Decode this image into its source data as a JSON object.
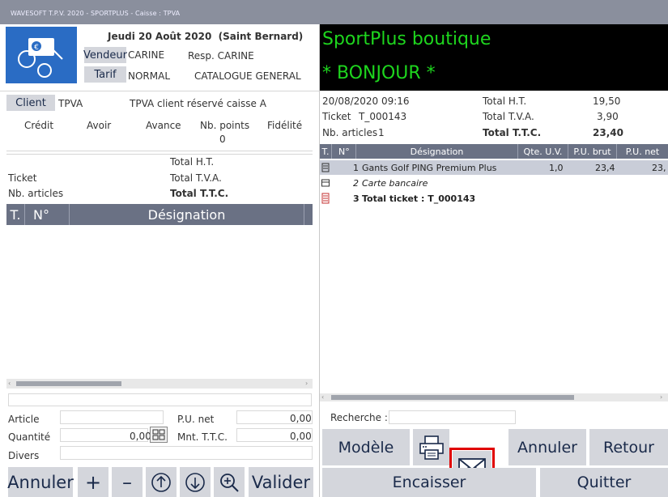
{
  "window": {
    "title": "WAVESOFT T.P.V. 2020 - SPORTPLUS - Caisse : TPVA"
  },
  "header": {
    "date": "Jeudi 20 Août 2020",
    "saint": "(Saint Bernard)",
    "vendeur_label": "Vendeur",
    "vendeur_value": "CARINE",
    "resp": "Resp. CARINE",
    "tarif_label": "Tarif",
    "tarif_value": "NORMAL",
    "catalogue": "CATALOGUE GENERAL"
  },
  "client": {
    "label": "Client",
    "code": "TPVA",
    "desc": "TPVA client réservé caisse A",
    "columns": [
      "Crédit",
      "Avoir",
      "Avance",
      "Nb. points",
      "Fidélité"
    ],
    "nb_points": "0"
  },
  "left_totals": {
    "total_ht": "Total H.T.",
    "ticket": "Ticket",
    "total_tva": "Total T.V.A.",
    "nb_articles": "Nb. articles",
    "total_ttc": "Total T.T.C."
  },
  "left_table": {
    "col_t": "T.",
    "col_n": "N°",
    "col_des": "Désignation"
  },
  "entry": {
    "article": "Article",
    "pu_net_label": "P.U. net",
    "pu_net_value": "0,00",
    "quantite": "Quantité",
    "quantite_value": "0,00",
    "mnt_label": "Mnt. T.T.C.",
    "mnt_value": "0,00",
    "divers": "Divers"
  },
  "left_buttons": {
    "annuler": "Annuler",
    "plus": "+",
    "minus": "–",
    "valider": "Valider"
  },
  "display": {
    "line1": "SportPlus boutique",
    "line2": "* BONJOUR *"
  },
  "ticket_info": {
    "datetime": "20/08/2020 09:16",
    "total_ht_label": "Total H.T.",
    "total_ht": "19,50",
    "ticket_label": "Ticket",
    "ticket_no": "T_000143",
    "total_tva_label": "Total T.V.A.",
    "total_tva": "3,90",
    "nb_articles_label": "Nb. articles",
    "nb_articles": "1",
    "total_ttc_label": "Total T.T.C.",
    "total_ttc": "23,40"
  },
  "right_table": {
    "headers": [
      "T.",
      "N°",
      "Désignation",
      "Qte. U.V.",
      "P.U. brut",
      "P.U. net"
    ],
    "rows": [
      {
        "n": "1",
        "des": "Gants Golf PING Premium Plus",
        "qte": "1,0",
        "pubrut": "23,4",
        "punet": "23,"
      },
      {
        "n": "2",
        "des": "Carte bancaire",
        "qte": "",
        "pubrut": "",
        "punet": ""
      },
      {
        "n": "3",
        "des": "Total ticket : T_000143",
        "qte": "",
        "pubrut": "",
        "punet": ""
      }
    ]
  },
  "recherche": {
    "label": "Recherche :"
  },
  "right_buttons": {
    "modele": "Modèle",
    "annuler": "Annuler",
    "retour": "Retour",
    "encaisser": "Encaisser",
    "quitter": "Quitter"
  },
  "colors": {
    "display_bg": "#000000",
    "display_fg": "#1ed61e",
    "accent_red": "#e00000",
    "header_bg": "#6a7184"
  }
}
